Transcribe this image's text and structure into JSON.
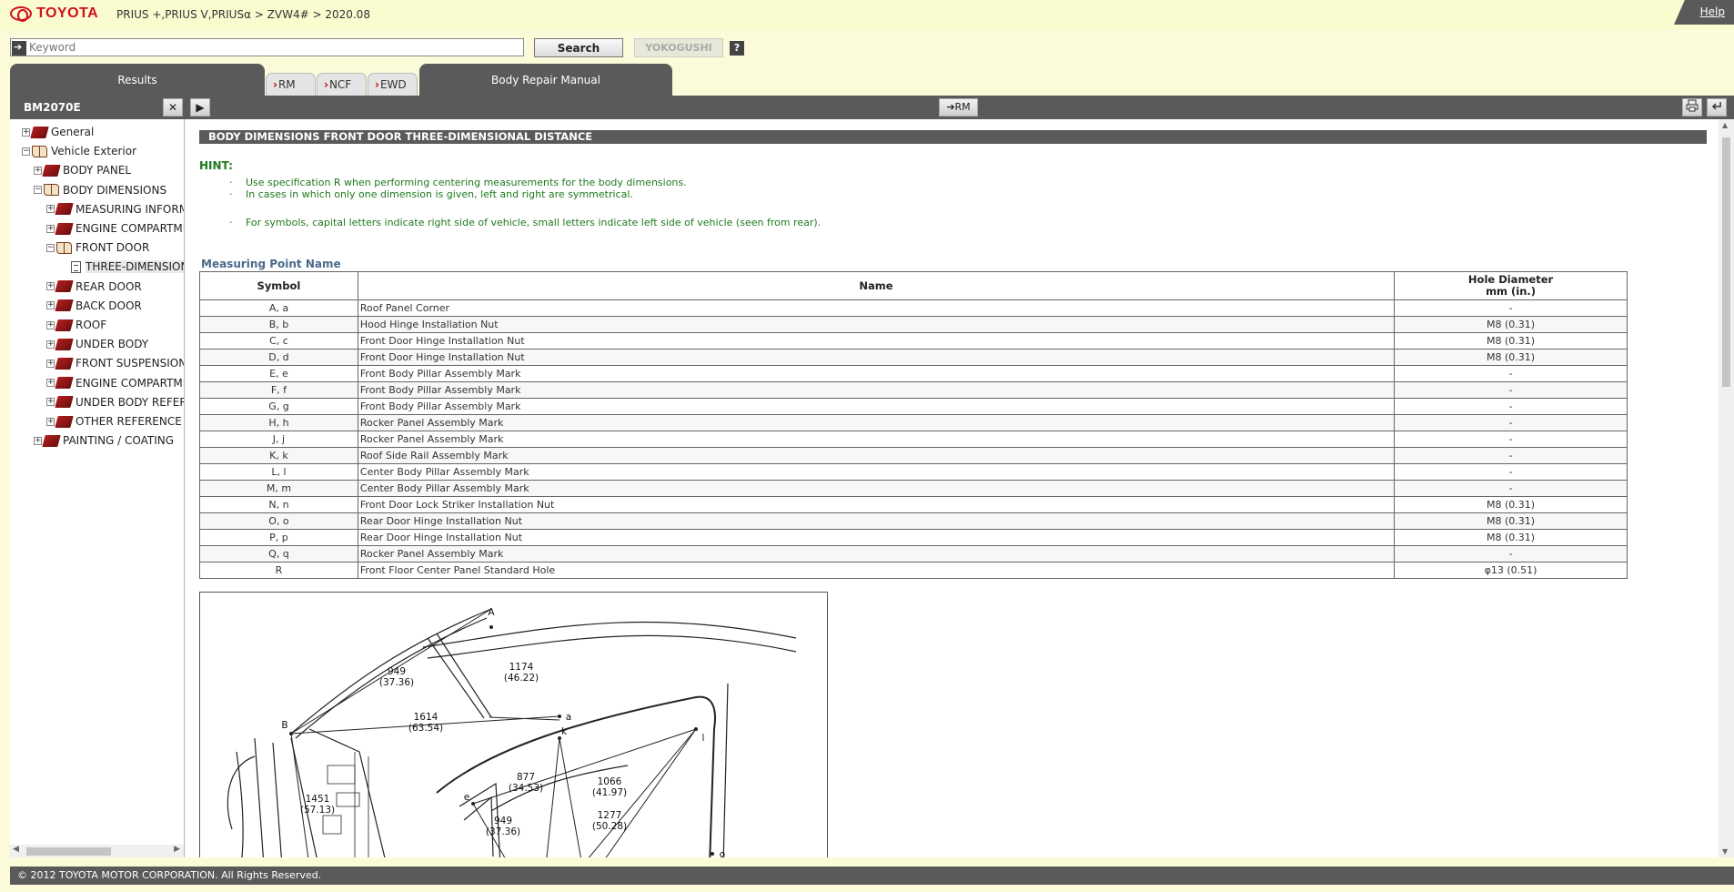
{
  "header": {
    "logo_text": "TOYOTA",
    "breadcrumb": "PRIUS +,PRIUS V,PRIUSα > ZVW4# > 2020.08",
    "help": "Help"
  },
  "search": {
    "placeholder": "Keyword",
    "search_label": "Search",
    "yokogushi_label": "YOKOGUSHI",
    "question_label": "?"
  },
  "tabs": {
    "results": "Results",
    "rm": "RM",
    "ncf": "NCF",
    "ewd": "EWD",
    "body_repair_manual": "Body Repair Manual"
  },
  "toolbar": {
    "panel_id": "BM2070E",
    "close": "✕",
    "expand": "▶",
    "rm_link": "➔RM"
  },
  "tree": [
    {
      "label": "General",
      "level": 0,
      "pm": "+",
      "icon": "book-closed"
    },
    {
      "label": "Vehicle Exterior",
      "level": 0,
      "pm": "−",
      "icon": "book-open"
    },
    {
      "label": "BODY PANEL",
      "level": 1,
      "pm": "+",
      "icon": "book-closed"
    },
    {
      "label": "BODY DIMENSIONS",
      "level": 1,
      "pm": "−",
      "icon": "book-open"
    },
    {
      "label": "MEASURING INFORMATION",
      "level": 2,
      "pm": "+",
      "icon": "book-closed"
    },
    {
      "label": "ENGINE COMPARTMENT",
      "level": 2,
      "pm": "+",
      "icon": "book-closed"
    },
    {
      "label": "FRONT DOOR",
      "level": 2,
      "pm": "−",
      "icon": "book-open"
    },
    {
      "label": "THREE-DIMENSIONAL DISTANCE",
      "level": 3,
      "pm": "",
      "icon": "doc",
      "selected": true
    },
    {
      "label": "REAR DOOR",
      "level": 2,
      "pm": "+",
      "icon": "book-closed"
    },
    {
      "label": "BACK DOOR",
      "level": 2,
      "pm": "+",
      "icon": "book-closed"
    },
    {
      "label": "ROOF",
      "level": 2,
      "pm": "+",
      "icon": "book-closed"
    },
    {
      "label": "UNDER BODY",
      "level": 2,
      "pm": "+",
      "icon": "book-closed"
    },
    {
      "label": "FRONT SUSPENSION",
      "level": 2,
      "pm": "+",
      "icon": "book-closed"
    },
    {
      "label": "ENGINE COMPARTMENT",
      "level": 2,
      "pm": "+",
      "icon": "book-closed"
    },
    {
      "label": "UNDER BODY REFERENCE",
      "level": 2,
      "pm": "+",
      "icon": "book-closed"
    },
    {
      "label": "OTHER REFERENCE VALUES",
      "level": 2,
      "pm": "+",
      "icon": "book-closed"
    },
    {
      "label": "PAINTING / COATING",
      "level": 1,
      "pm": "+",
      "icon": "book-closed"
    }
  ],
  "document": {
    "title": "BODY DIMENSIONS  FRONT DOOR  THREE-DIMENSIONAL DISTANCE",
    "hint_label": "HINT:",
    "hints": [
      "Use specification R when performing centering measurements for the body dimensions.",
      "In cases in which only one dimension is given, left and right are symmetrical.",
      "For symbols, capital letters indicate right side of vehicle, small letters indicate left side of vehicle (seen from rear)."
    ],
    "bullet": "·",
    "table_heading": "Measuring Point Name",
    "columns": [
      "Symbol",
      "Name",
      "Hole Diameter",
      "mm (in.)"
    ],
    "rows": [
      [
        "A, a",
        "Roof Panel Corner",
        "-"
      ],
      [
        "B, b",
        "Hood Hinge Installation Nut",
        "M8 (0.31)"
      ],
      [
        "C, c",
        "Front Door Hinge Installation Nut",
        "M8 (0.31)"
      ],
      [
        "D, d",
        "Front Door Hinge Installation Nut",
        "M8 (0.31)"
      ],
      [
        "E, e",
        "Front Body Pillar Assembly Mark",
        "-"
      ],
      [
        "F, f",
        "Front Body Pillar Assembly Mark",
        "-"
      ],
      [
        "G, g",
        "Front Body Pillar Assembly Mark",
        "-"
      ],
      [
        "H, h",
        "Rocker Panel Assembly Mark",
        "-"
      ],
      [
        "J, j",
        "Rocker Panel Assembly Mark",
        "-"
      ],
      [
        "K, k",
        "Roof Side Rail Assembly Mark",
        "-"
      ],
      [
        "L, l",
        "Center Body Pillar Assembly Mark",
        "-"
      ],
      [
        "M, m",
        "Center Body Pillar Assembly Mark",
        "-"
      ],
      [
        "N, n",
        "Front Door Lock Striker Installation Nut",
        "M8 (0.31)"
      ],
      [
        "O, o",
        "Rear Door Hinge Installation Nut",
        "M8 (0.31)"
      ],
      [
        "P, p",
        "Rear Door Hinge Installation Nut",
        "M8 (0.31)"
      ],
      [
        "Q, q",
        "Rocker Panel Assembly Mark",
        "-"
      ],
      [
        "R",
        "Front Floor Center Panel Standard Hole",
        "φ13 (0.51)"
      ]
    ],
    "figure_labels": {
      "A": "A",
      "a": "a",
      "B": "B",
      "k": "k",
      "l": "l",
      "e": "e",
      "o": "o",
      "d949": "949",
      "d949in": "(37.36)",
      "d1174": "1174",
      "d1174in": "(46.22)",
      "d1614": "1614",
      "d1614in": "(63.54)",
      "d877": "877",
      "d877in": "(34.53)",
      "d1066": "1066",
      "d1066in": "(41.97)",
      "d1277": "1277",
      "d1277in": "(50.28)",
      "d1451": "1451",
      "d1451in": "(57.13)",
      "d949b": "949",
      "d949bin": "(37.36)"
    }
  },
  "footer": {
    "copyright": "© 2012 TOYOTA MOTOR CORPORATION. All Rights Reserved."
  }
}
